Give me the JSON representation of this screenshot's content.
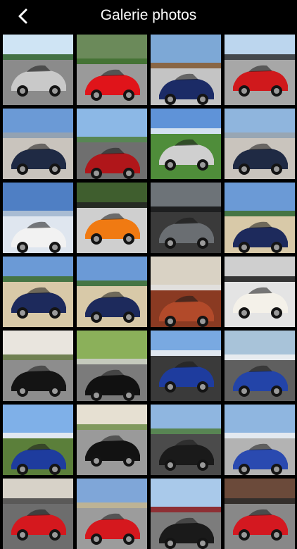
{
  "header": {
    "title": "Galerie photos",
    "back_icon": "chevron-left-icon"
  },
  "gallery": {
    "photos": [
      {
        "sky": "#cfe4f4",
        "ground": "#8b8b8b",
        "car": "#c9c9c9",
        "accent": "#2a5d24"
      },
      {
        "sky": "#6b8a5a",
        "ground": "#9a9a9a",
        "car": "#e0141a",
        "accent": "#3e6e2f"
      },
      {
        "sky": "#7da8d6",
        "ground": "#c4c4c4",
        "car": "#1b2b66",
        "accent": "#8b5a2b"
      },
      {
        "sky": "#bcd6ee",
        "ground": "#a7a7a7",
        "car": "#d0191c",
        "accent": "#2f2f2f"
      },
      {
        "sky": "#6b9ad6",
        "ground": "#c9c4bd",
        "car": "#1f2a44",
        "accent": "#9aa3ab"
      },
      {
        "sky": "#8cb8e6",
        "ground": "#6f6f6f",
        "car": "#b0161a",
        "accent": "#4f7d3a"
      },
      {
        "sky": "#5f93d8",
        "ground": "#4f8d3a",
        "car": "#cfcfcf",
        "accent": "#e8eef5"
      },
      {
        "sky": "#8fb5dd",
        "ground": "#c9c4bd",
        "car": "#1f2a44",
        "accent": "#9aa3ab"
      },
      {
        "sky": "#4f7fc4",
        "ground": "#dfe6ef",
        "car": "#f2f2f2",
        "accent": "#b9c7d6"
      },
      {
        "sky": "#3f5e2e",
        "ground": "#cfcfcf",
        "car": "#f07a12",
        "accent": "#222222"
      },
      {
        "sky": "#6d7378",
        "ground": "#3a3a3a",
        "car": "#6a6e72",
        "accent": "#111111"
      },
      {
        "sky": "#6b9ad6",
        "ground": "#d8c9a8",
        "car": "#1d2a5c",
        "accent": "#3f6e2a"
      },
      {
        "sky": "#6b9ad6",
        "ground": "#d8c9a8",
        "car": "#1d2a5c",
        "accent": "#3f6e2a"
      },
      {
        "sky": "#6b9ad6",
        "ground": "#d8c9a8",
        "car": "#1d2a5c",
        "accent": "#3f6e2a"
      },
      {
        "sky": "#d9d2c4",
        "ground": "#8a3a22",
        "car": "#b24a2a",
        "accent": "#e2e2e2"
      },
      {
        "sky": "#cfcfcf",
        "ground": "#e4e4e4",
        "car": "#f4f1e9",
        "accent": "#1a1a1a"
      },
      {
        "sky": "#e9e5de",
        "ground": "#8d8d8d",
        "car": "#141414",
        "accent": "#5a6e3a"
      },
      {
        "sky": "#8bb05a",
        "ground": "#7b7b7b",
        "car": "#111111",
        "accent": "#cfcfcf"
      },
      {
        "sky": "#79a9e1",
        "ground": "#3a3a3a",
        "car": "#1e3c9e",
        "accent": "#f2f2f2"
      },
      {
        "sky": "#a8c3d9",
        "ground": "#5f5f5f",
        "car": "#2344a8",
        "accent": "#f2f2f2"
      },
      {
        "sky": "#7fb0e8",
        "ground": "#5b7f3a",
        "car": "#1e3c9e",
        "accent": "#f2f2f2"
      },
      {
        "sky": "#e6e0d2",
        "ground": "#9a9a9a",
        "car": "#121212",
        "accent": "#6d8c4a"
      },
      {
        "sky": "#8fb6e0",
        "ground": "#4b4b4b",
        "car": "#1a1a1a",
        "accent": "#4f7d3a"
      },
      {
        "sky": "#8fb6e0",
        "ground": "#b3b3b3",
        "car": "#2a4ab0",
        "accent": "#f2f2f2"
      },
      {
        "sky": "#d7d2c8",
        "ground": "#6d6d6d",
        "car": "#d5181e",
        "accent": "#444444"
      },
      {
        "sky": "#7fa6d8",
        "ground": "#9c9c9c",
        "car": "#d5181e",
        "accent": "#c8b58a"
      },
      {
        "sky": "#a9c9ea",
        "ground": "#7c7c7c",
        "car": "#1a1a1a",
        "accent": "#8a1414"
      },
      {
        "sky": "#6b4a3a",
        "ground": "#888888",
        "car": "#d41820",
        "accent": "#2a2a2a"
      }
    ]
  }
}
